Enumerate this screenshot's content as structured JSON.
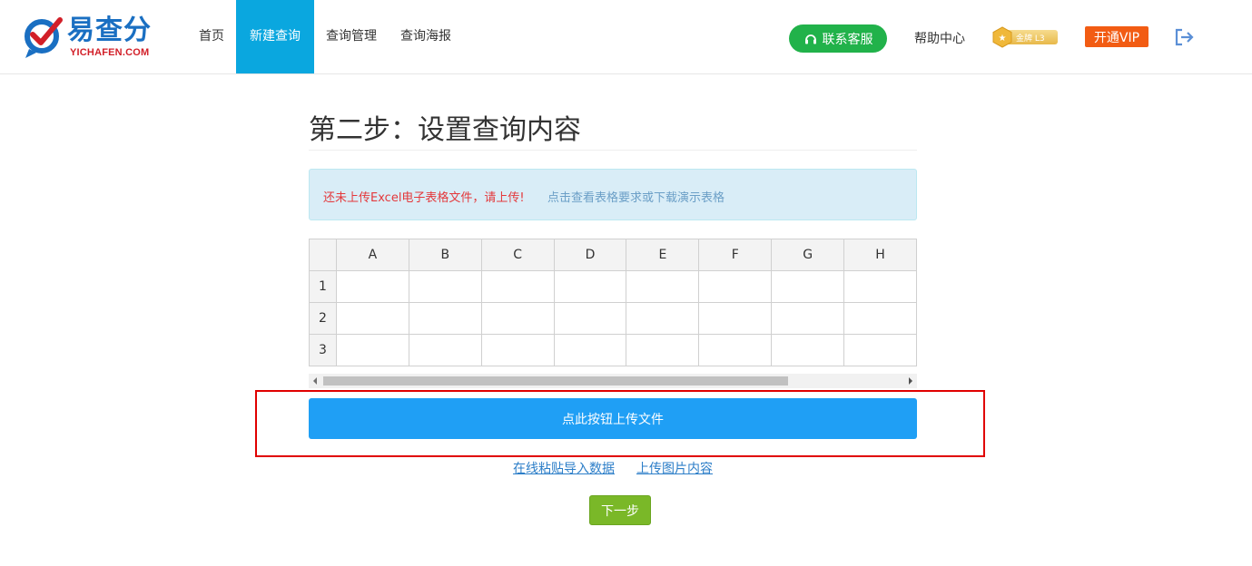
{
  "header": {
    "logo": {
      "text": "易查分",
      "sub": "YICHAFEN.COM"
    },
    "nav": [
      {
        "label": "首页"
      },
      {
        "label": "新建查询",
        "active": true
      },
      {
        "label": "查询管理"
      },
      {
        "label": "查询海报"
      }
    ],
    "contact_label": "联系客服",
    "help_label": "帮助中心",
    "badge_label": "金牌 L3",
    "vip_label": "开通VIP"
  },
  "main": {
    "title": "第二步：设置查询内容",
    "alert": {
      "warning": "还未上传Excel电子表格文件，请上传!",
      "link": "点击查看表格要求或下载演示表格"
    },
    "sheet": {
      "columns": [
        "A",
        "B",
        "C",
        "D",
        "E",
        "F",
        "G",
        "H"
      ],
      "rows": [
        "1",
        "2",
        "3"
      ]
    },
    "upload_label": "点此按钮上传文件",
    "paste_link": "在线粘贴导入数据",
    "image_link": "上传图片内容",
    "next_label": "下一步"
  },
  "colors": {
    "nav_active": "#0aa7df",
    "contact": "#21b24a",
    "vip": "#f25c13",
    "upload": "#1f9ff5",
    "next": "#7ab828",
    "highlight": "#e00000"
  }
}
